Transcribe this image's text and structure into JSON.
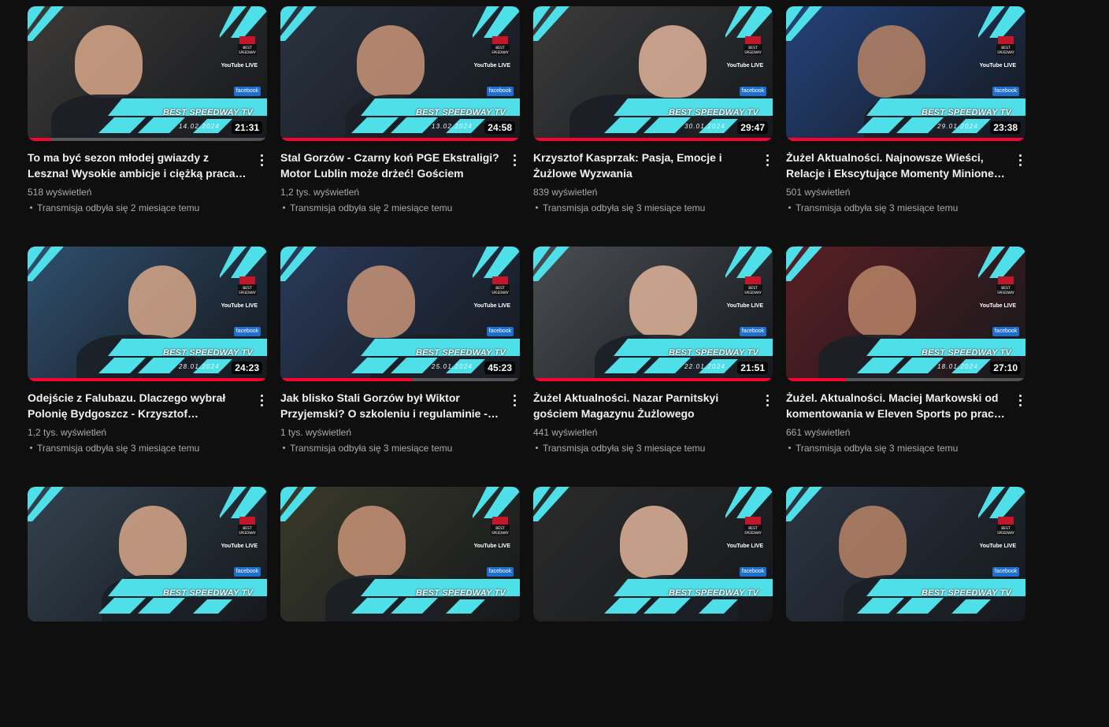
{
  "accent_color": "#4fdfe9",
  "progress_color": "#ff0033",
  "brand": "BEST SPEEDWAY TV",
  "logo_caption": "BEST SPEEDWAY TV",
  "youtube_badge": "YouTube LIVE",
  "facebook_badge": "facebook",
  "videos": [
    {
      "title": "To ma być sezon młodej gwiazdy z Leszna! Wysokie ambicje i ciężką praca kluczem do sukcesu",
      "views": "518 wyświetleń",
      "time": "Transmisja odbyła się 2 miesiące temu",
      "duration": "21:31",
      "date": "14.02.2024",
      "progress": 0.1,
      "bg": "#3c3a38"
    },
    {
      "title": "Stal Gorzów - Czarny koń PGE Ekstraligi? Motor Lublin może drżeć! Gościem",
      "views": "1,2 tys. wyświetleń",
      "time": "Transmisja odbyła się 2 miesiące temu",
      "duration": "24:58",
      "date": "13.02.2024",
      "progress": 1.0,
      "bg": "#2a3340"
    },
    {
      "title": "Krzysztof Kasprzak: Pasja, Emocje i Żużlowe Wyzwania",
      "views": "839 wyświetleń",
      "time": "Transmisja odbyła się 3 miesiące temu",
      "duration": "29:47",
      "date": "30.01.2024",
      "progress": 1.0,
      "bg": "#3b3b3b"
    },
    {
      "title": "Żużel Aktualności. Najnowsze Wieści, Relacje i Ekscytujące Momenty Minionego Tygodnia",
      "views": "501 wyświetleń",
      "time": "Transmisja odbyła się 3 miesiące temu",
      "duration": "23:38",
      "date": "29.01.2024",
      "progress": 1.0,
      "bg": "#24427a"
    },
    {
      "title": "Odejście z Falubazu. Dlaczego wybrał Polonię Bydgoszcz - Krzysztof Buczkowski",
      "views": "1,2 tys. wyświetleń",
      "time": "Transmisja odbyła się 3 miesiące temu",
      "duration": "24:23",
      "date": "28.01.2024",
      "progress": 1.0,
      "bg": "#2f4f6e"
    },
    {
      "title": "Jak blisko Stali Gorzów był Wiktor Przyjemski? O szkoleniu i regulaminie - rozmowa",
      "views": "1 tys. wyświetleń",
      "time": "Transmisja odbyła się 3 miesiące temu",
      "duration": "45:23",
      "date": "25.01.2024",
      "progress": 0.55,
      "bg": "#2a3a5a"
    },
    {
      "title": "Żużel Aktualności. Nazar Parnitskyi gościem Magazynu Żużlowego",
      "views": "441 wyświetleń",
      "time": "Transmisja odbyła się 3 miesiące temu",
      "duration": "21:51",
      "date": "22.01.2024",
      "progress": 1.0,
      "bg": "#4a4d52"
    },
    {
      "title": "Żużel. Aktualności. Maciej Markowski od komentowania w Eleven Sports po prace w klubie",
      "views": "661 wyświetleń",
      "time": "Transmisja odbyła się 3 miesiące temu",
      "duration": "27:10",
      "date": "18.01.2024",
      "progress": 0.25,
      "bg": "#5a1f24"
    },
    {
      "title": "",
      "views": "",
      "time": "",
      "duration": "",
      "date": "",
      "progress": 0,
      "bg": "#33424f"
    },
    {
      "title": "",
      "views": "",
      "time": "",
      "duration": "",
      "date": "",
      "progress": 0,
      "bg": "#3a3a2a"
    },
    {
      "title": "",
      "views": "",
      "time": "",
      "duration": "",
      "date": "",
      "progress": 0,
      "bg": "#2b2b2b"
    },
    {
      "title": "",
      "views": "",
      "time": "",
      "duration": "",
      "date": "",
      "progress": 0,
      "bg": "#2c3542"
    }
  ]
}
